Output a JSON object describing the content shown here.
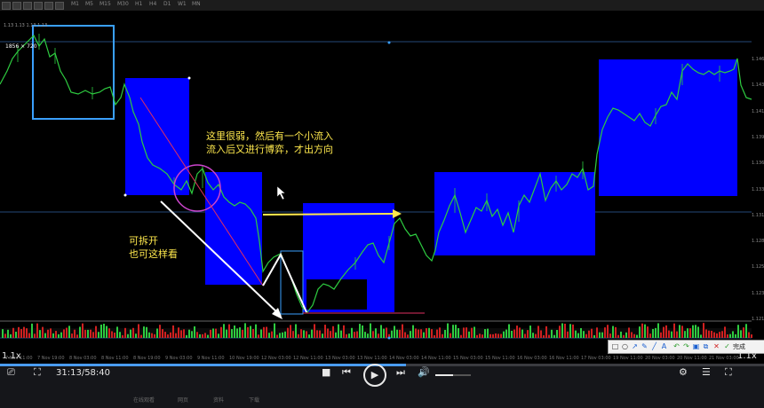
{
  "window": {
    "title": "",
    "toolbar_text": [
      "M1",
      "M5",
      "M15",
      "M30",
      "H1",
      "H4",
      "D1",
      "W1",
      "MN"
    ]
  },
  "chart": {
    "ohlc_line": "1.13 1.13 1.13 1.13",
    "resolution_label": "1856 × 720",
    "annotation_main": [
      "这里很弱，然后有一个小流入",
      "流入后又进行博弈，才出方向"
    ],
    "annotation_side": [
      "可拆开",
      "也可这样看"
    ],
    "price_ticks": [
      "1.146",
      "1.143",
      "1.141",
      "1.139",
      "1.136",
      "1.133",
      "1.131",
      "1.128",
      "1.125",
      "1.123",
      "1.121"
    ],
    "date_ticks": [
      "7 Nov 11:00",
      "7 Nov 19:00",
      "8 Nov 03:00",
      "8 Nov 11:00",
      "8 Nov 19:00",
      "9 Nov 03:00",
      "9 Nov 11:00",
      "10 Nov 19:00",
      "12 Nov 03:00",
      "12 Nov 11:00",
      "13 Nov 03:00",
      "13 Nov 11:00",
      "14 Nov 03:00",
      "14 Nov 11:00",
      "15 Nov 03:00",
      "15 Nov 11:00",
      "16 Nov 03:00",
      "16 Nov 11:00",
      "17 Nov 03:00",
      "19 Nov 11:00",
      "20 Nov 03:00",
      "20 Nov 11:00",
      "21 Nov 03:00"
    ],
    "colors": {
      "zone_blue": "#0000ff",
      "frame_blue": "#3aa0ff",
      "annotation_yellow": "#ffe94d",
      "candle_up": "#2ecc40",
      "arrow_white": "#ffffff",
      "circle_magenta": "#cc44cc"
    }
  },
  "draw_toolbar": {
    "icons": [
      "rect-icon",
      "ellipse-icon",
      "arrow-icon",
      "pen-icon",
      "line-icon",
      "text-icon",
      "undo-icon",
      "redo-icon",
      "save-icon",
      "copy-icon",
      "close-icon",
      "confirm-icon"
    ],
    "confirm_label": "完成"
  },
  "player": {
    "speed_left": "1.1x",
    "speed_right": "1.1x",
    "time": "31:13/58:40",
    "progress": 0.531,
    "volume": 0.5,
    "controls": {
      "stop": "■",
      "prev": "⏮",
      "play": "▶",
      "next": "⏭",
      "volume": "🔊"
    }
  },
  "taskbar": {
    "items": [
      "在线观看",
      "网页",
      "资料",
      "下载"
    ]
  }
}
